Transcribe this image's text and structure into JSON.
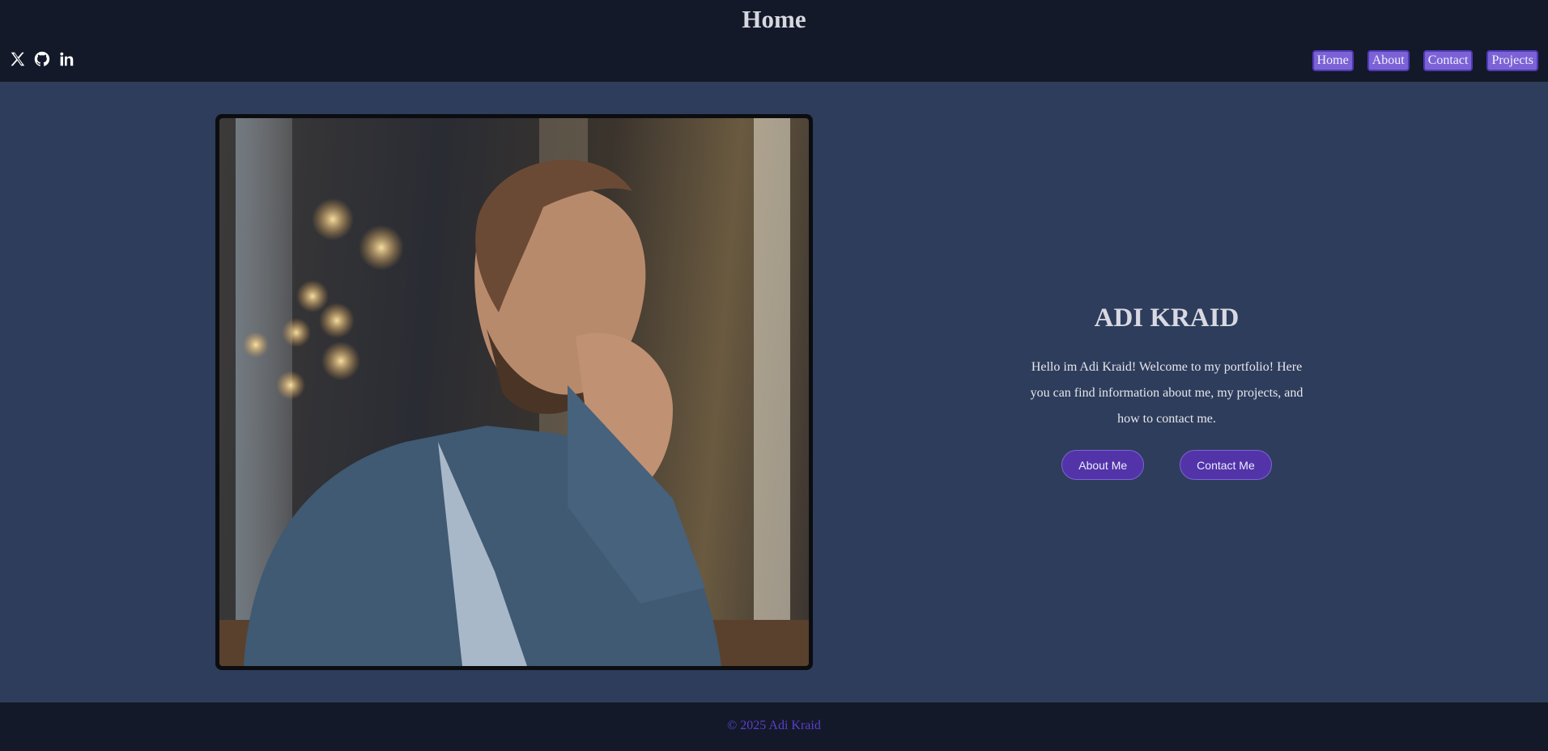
{
  "header": {
    "title": "Home"
  },
  "social": [
    {
      "icon": "x-icon"
    },
    {
      "icon": "github-icon"
    },
    {
      "icon": "linkedin-icon"
    }
  ],
  "nav": {
    "items": [
      {
        "label": "Home"
      },
      {
        "label": "About"
      },
      {
        "label": "Contact"
      },
      {
        "label": "Projects"
      }
    ]
  },
  "hero": {
    "name": "ADI KRAID",
    "text": "Hello im Adi Kraid! Welcome to my portfolio! Here you can find information about me, my projects, and how to contact me.",
    "about_button": "About Me",
    "contact_button": "Contact Me"
  },
  "footer": {
    "text": "© 2025 Adi Kraid"
  },
  "colors": {
    "page_background": "#2e3d5b",
    "bar_background": "#131928",
    "nav_button": "#7b63d6",
    "cta_button": "#5234a8",
    "footer_text": "#5b3fcf"
  }
}
